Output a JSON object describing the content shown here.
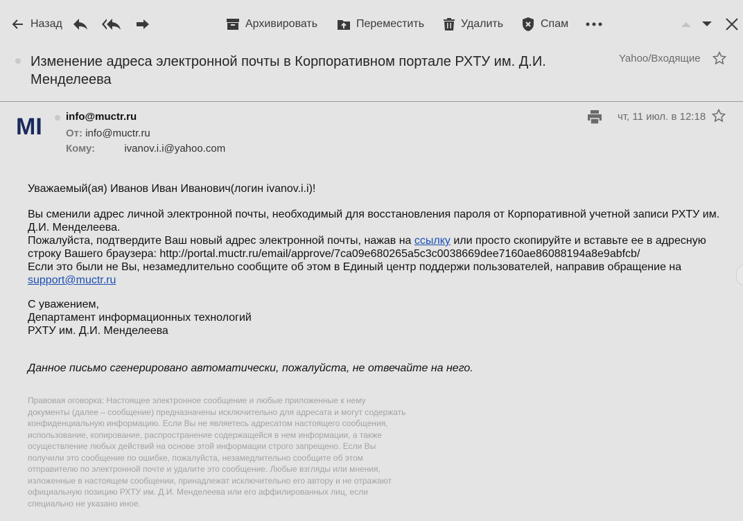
{
  "toolbar": {
    "back_label": "Назад",
    "archive_label": "Архивировать",
    "move_label": "Переместить",
    "delete_label": "Удалить",
    "spam_label": "Спам"
  },
  "message": {
    "subject": "Изменение адреса электронной почты в Корпоративном портале РХТУ им. Д.И. Менделеева",
    "folder": "Yahoo/Входящие",
    "avatar_text": "MI",
    "sender": "info@muctr.ru",
    "from_label": "От:",
    "from_value": "info@muctr.ru",
    "to_label": "Кому:",
    "to_value": "ivanov.i.i@yahoo.com",
    "date": "чт, 11 июл. в 12:18"
  },
  "body": {
    "greeting_a": "Уважаемый(ая) Иванов Иван Иванович(логин ivanov.i.i",
    "greeting_b": ")!",
    "para1": "Вы сменили адрес личной электронной почты, необходимый для восстановления пароля от Корпоративной учетной записи РХТУ им. Д.И. Менделеева.",
    "para2_a": "Пожалуйста, подтвердите Ваш новый адрес электронной почты, нажав на ",
    "para2_link": "ссылку",
    "para2_b": " или просто скопируйте и вставьте ее в адресную строку Вашего браузера: ",
    "para2_url": "http://portal.muctr.ru/email/approve/7ca09e680265a5c3c0038669dee7160ae86088194a8e9abfcb/",
    "para3": "Если это были не Вы, незамедлительно сообщите об этом в Единый центр поддержи пользователей, направив обращение на",
    "support_link": "support@muctr.ru",
    "sign1": "С уважением,",
    "sign2": "Департамент информационных технологий",
    "sign3": "РХТУ им. Д.И. Менделеева",
    "auto_note": "Данное письмо сгенерировано автоматически, пожалуйста, не отвечайте на него.",
    "disclaimer": "Правовая оговорка: Настоящее электронное сообщение и любые приложенные к нему документы (далее – сообщение) предназначены исключительно для адресата и могут содержать конфиденциальную информацию. Если Вы не являетесь адресатом настоящего сообщения, использование, копирование, распространение содержащейся в нем информации, а также осуществление любых действий на основе этой информации строго запрещено. Если Вы получили это сообщение по ошибке, пожалуйста, незамедлительно сообщите об этом отправителю по электронной почте и удалите это сообщение. Любые взгляды или мнения, изложенные в настоящем сообщении, принадлежат исключительно его автору и не отражают официальную позицию РХТУ им. Д.И. Менделеева или его аффилированных лиц, если специально не указано иное."
  },
  "colors": {
    "background": "#e4e4e4",
    "link": "#1b4fb3",
    "avatar_navy": "#1a2a5e"
  },
  "icons": [
    "back-arrow-icon",
    "reply-icon",
    "reply-all-icon",
    "forward-icon",
    "archive-icon",
    "move-icon",
    "trash-icon",
    "spam-shield-icon",
    "more-icon",
    "prev-message-icon",
    "next-message-icon",
    "close-icon",
    "star-icon",
    "print-icon"
  ]
}
